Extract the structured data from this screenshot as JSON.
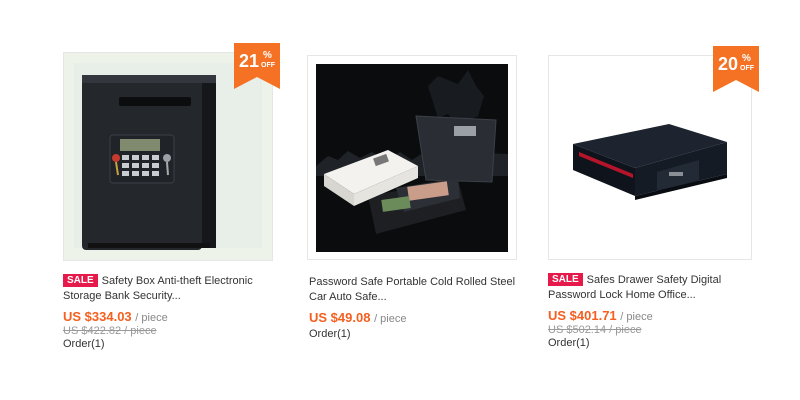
{
  "products": [
    {
      "title": "Safety Box Anti-theft Electronic Storage Bank Security...",
      "sale_badge": "SALE",
      "discount": {
        "number": "21",
        "percent": "%",
        "off": "OFF"
      },
      "price": "US $334.03",
      "unit": "/ piece",
      "old_price": "US $422.82 / piece",
      "orders": "Order(1)"
    },
    {
      "title": "Password Safe Portable Cold Rolled Steel Car Auto Safe...",
      "price": "US $49.08",
      "unit": "/ piece",
      "orders": "Order(1)"
    },
    {
      "title": "Safes Drawer Safety Digital Password Lock Home Office...",
      "sale_badge": "SALE",
      "discount": {
        "number": "20",
        "percent": "%",
        "off": "OFF"
      },
      "price": "US $401.71",
      "unit": "/ piece",
      "old_price": "US $502.14 / piece",
      "orders": "Order(1)"
    }
  ],
  "colors": {
    "sale_badge": "#e5194a",
    "discount_badge": "#f57224",
    "price": "#f55f1f"
  }
}
